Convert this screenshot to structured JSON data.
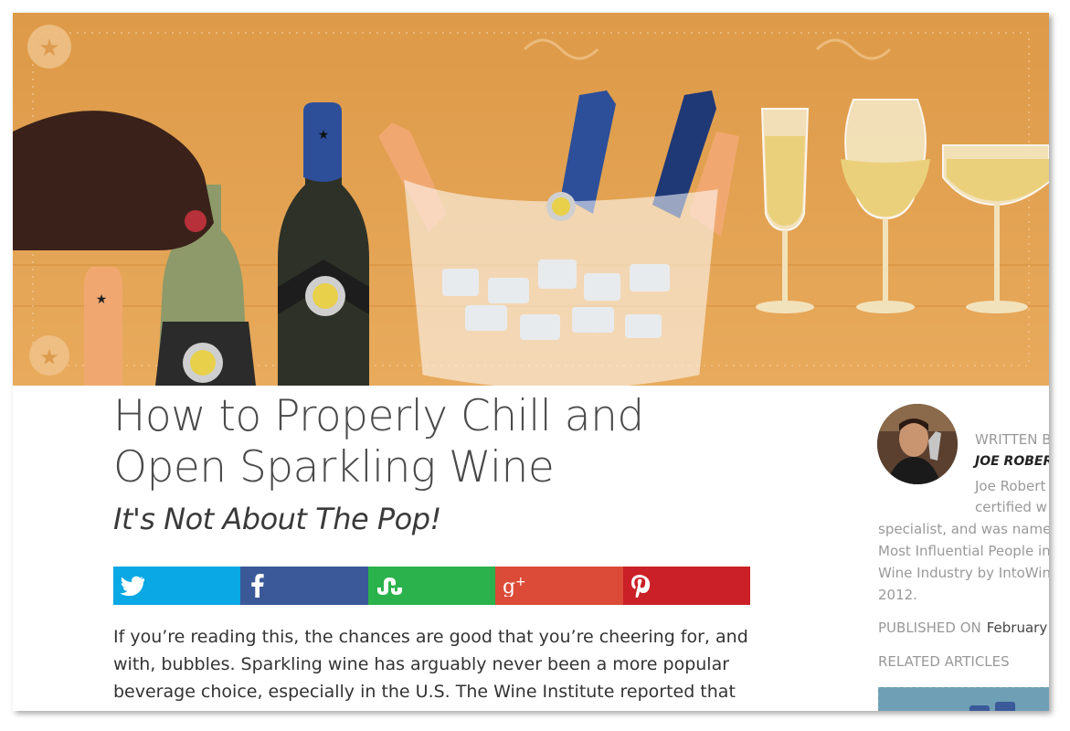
{
  "article": {
    "title": "How to Properly Chill and Open Sparkling Wine",
    "subtitle": "It's Not About The Pop!",
    "body": "If you’re reading this, the chances are good that you’re cheering for, and with, bubbles. Sparkling wine has arguably never been a more popular beverage choice, especially in the U.S. The Wine Institute reported that in"
  },
  "share": [
    {
      "network": "twitter",
      "icon": "twitter-icon",
      "color": "#0aa8e4"
    },
    {
      "network": "facebook",
      "icon": "facebook-icon",
      "color": "#3b5998"
    },
    {
      "network": "stumbleupon",
      "icon": "stumbleupon-icon",
      "color": "#2bb24c"
    },
    {
      "network": "google-plus",
      "icon": "google-plus-icon",
      "color": "#dc4a38"
    },
    {
      "network": "pinterest",
      "icon": "pinterest-icon",
      "color": "#cb2027"
    }
  ],
  "sidebar": {
    "written_by_label": "WRITTEN B",
    "author_name": "JOE ROBERT",
    "bio_lines": [
      "Joe Robert",
      "certified w",
      "specialist, and was name",
      "Most Influential People in",
      "Wine Industry by IntoWin",
      "2012."
    ],
    "published_label": "PUBLISHED ON",
    "published_value": "February",
    "related_label": "RELATED ARTICLES"
  },
  "colors": {
    "hero_background": "#e3a04e",
    "title_text": "#4a4a4a"
  }
}
